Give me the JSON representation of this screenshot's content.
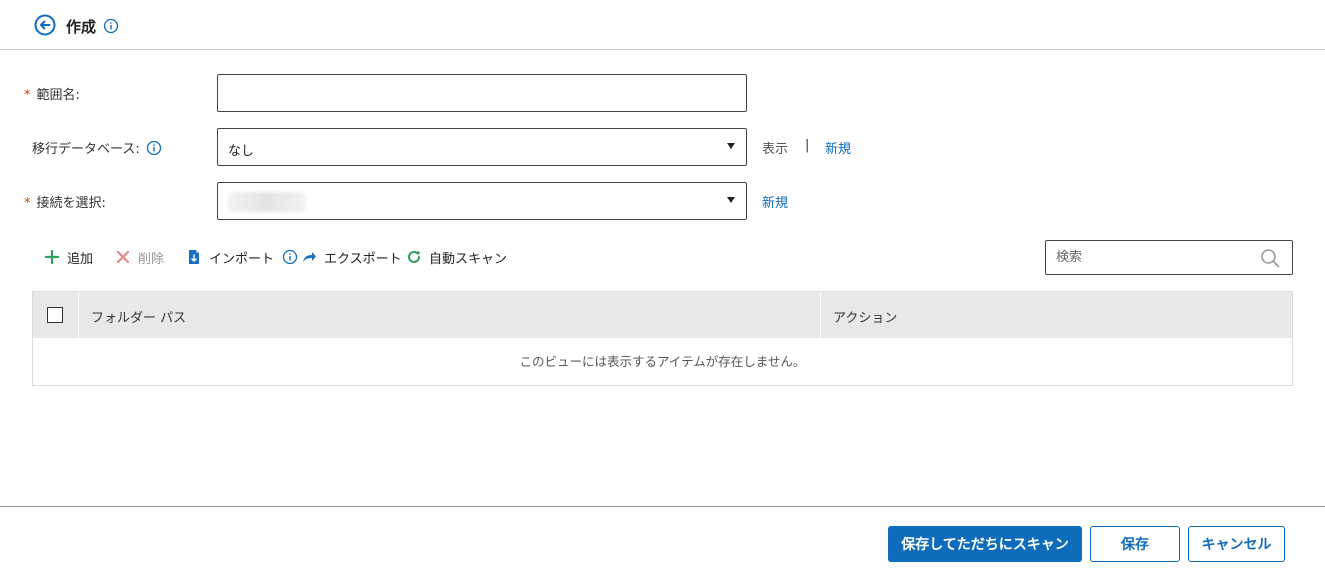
{
  "header": {
    "title": "作成"
  },
  "form": {
    "scope_name": {
      "label": "範囲名:",
      "value": ""
    },
    "migration_db": {
      "label": "移行データベース:",
      "value": "なし",
      "view_link": "表示",
      "separator": "|",
      "new_link": "新規"
    },
    "connection": {
      "label": "接続を選択:",
      "new_link": "新規"
    },
    "required_mark": "*"
  },
  "toolbar": {
    "add": "追加",
    "delete": "削除",
    "import": "インポート",
    "export": "エクスポート",
    "auto_scan": "自動スキャン"
  },
  "search": {
    "placeholder": "検索"
  },
  "grid": {
    "columns": [
      "フォルダー パス",
      "アクション"
    ],
    "empty_message": "このビューには表示するアイテムが存在しません。"
  },
  "footer": {
    "save_and_scan": "保存してただちにスキャン",
    "save": "保存",
    "cancel": "キャンセル"
  },
  "colors": {
    "accent": "#0f6cbd",
    "required": "#d83b01",
    "add_icon": "#2e9e5b",
    "delete_icon": "#e08a8a"
  }
}
